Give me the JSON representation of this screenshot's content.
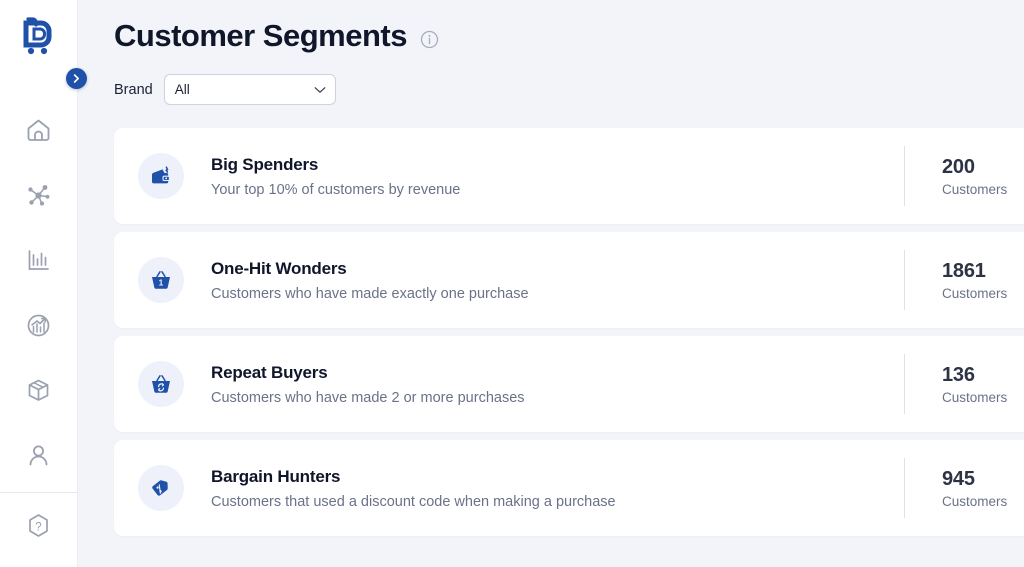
{
  "brand": {
    "logo_name": "shopping-cart-b-logo",
    "primary_color": "#1f51a9",
    "icon_bg_color": "#eef1fa",
    "page_bg_color": "#f3f4f9"
  },
  "sidebar": {
    "collapse_toggle_label": "›",
    "items": [
      {
        "icon": "home-icon",
        "label": "Home"
      },
      {
        "icon": "network-hub-icon",
        "label": "Integrations"
      },
      {
        "icon": "bar-chart-icon",
        "label": "Reports"
      },
      {
        "icon": "growth-analytics-icon",
        "label": "Analytics"
      },
      {
        "icon": "package-box-icon",
        "label": "Products"
      },
      {
        "icon": "person-icon",
        "label": "Customers"
      }
    ],
    "bottom_items": [
      {
        "icon": "help-hexagon-icon",
        "label": "Help"
      }
    ]
  },
  "header": {
    "title": "Customer Segments",
    "info_icon": "info-circle-icon"
  },
  "filters": {
    "brand": {
      "label": "Brand",
      "value": "All",
      "placeholder": "All",
      "chevron_icon": "chevron-down-icon",
      "options": [
        "All"
      ]
    }
  },
  "segments": {
    "stat_unit": "Customers",
    "items": [
      {
        "icon": "wallet-icon",
        "title": "Big Spenders",
        "description": "Your top 10% of customers by revenue",
        "count": "200",
        "unit": "Customers"
      },
      {
        "icon": "basket-one-icon",
        "title": "One-Hit Wonders",
        "description": "Customers who have made exactly one purchase",
        "count": "1861",
        "unit": "Customers"
      },
      {
        "icon": "basket-repeat-icon",
        "title": "Repeat Buyers",
        "description": "Customers who have made 2 or more purchases",
        "count": "136",
        "unit": "Customers"
      },
      {
        "icon": "discount-tag-icon",
        "title": "Bargain Hunters",
        "description": "Customers that used a discount code when making a purchase",
        "count": "945",
        "unit": "Customers"
      }
    ]
  }
}
